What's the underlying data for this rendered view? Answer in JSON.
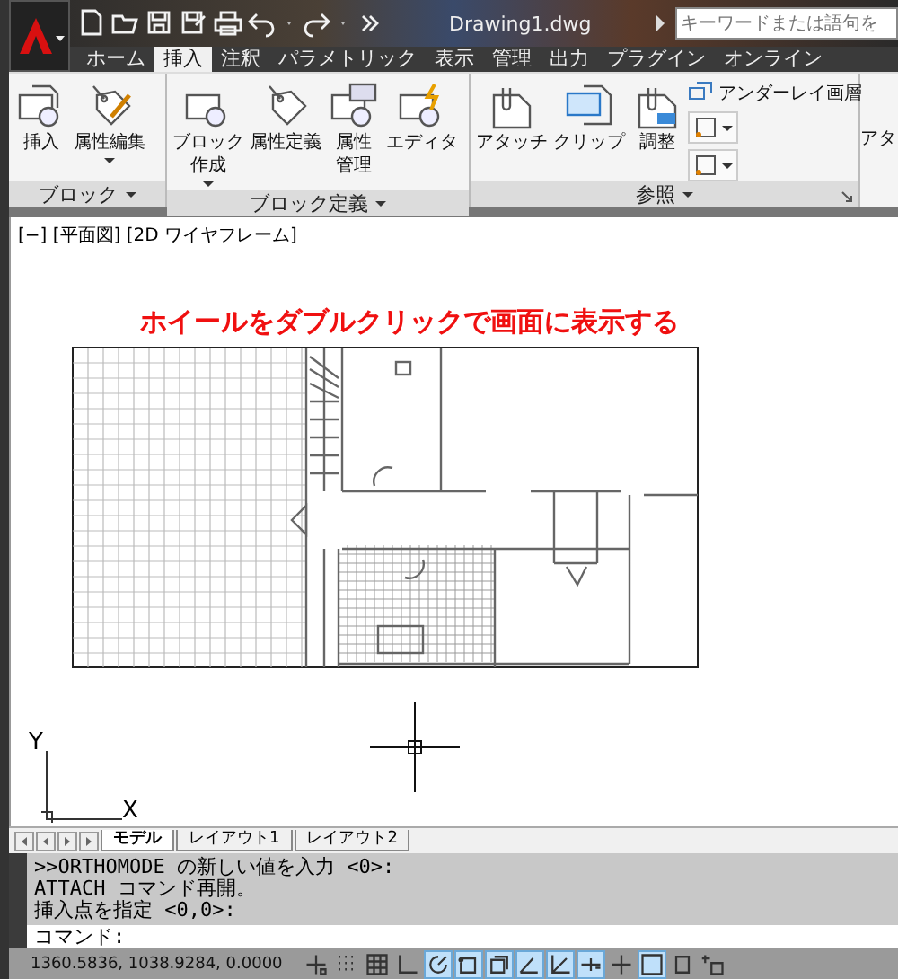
{
  "title_bar": {
    "file_title": "Drawing1.dwg",
    "search": {
      "placeholder": "キーワードまたは語句を"
    }
  },
  "quick_access": [
    {
      "kind": "new"
    },
    {
      "kind": "open"
    },
    {
      "kind": "save"
    },
    {
      "kind": "saveas"
    },
    {
      "kind": "print"
    },
    {
      "kind": "undo"
    },
    {
      "kind": "caret"
    },
    {
      "kind": "redo"
    },
    {
      "kind": "caret"
    },
    {
      "kind": "more"
    }
  ],
  "tabs": [
    {
      "label": "ホーム",
      "selected": false
    },
    {
      "label": "挿入",
      "selected": true
    },
    {
      "label": "注釈",
      "selected": false
    },
    {
      "label": "パラメトリック",
      "selected": false
    },
    {
      "label": "表示",
      "selected": false
    },
    {
      "label": "管理",
      "selected": false
    },
    {
      "label": "出力",
      "selected": false
    },
    {
      "label": "プラグイン",
      "selected": false
    },
    {
      "label": "オンライン",
      "selected": false
    }
  ],
  "panels": [
    {
      "title": "ブロック",
      "launcher": false,
      "buttons": [
        {
          "lines": [
            "挿入"
          ],
          "dropdown": false
        },
        {
          "lines": [
            "属性編集"
          ],
          "dropdown": true
        }
      ]
    },
    {
      "title": "ブロック定義",
      "launcher": false,
      "buttons": [
        {
          "lines": [
            "ブロック",
            "作成"
          ],
          "dropdown": true
        },
        {
          "lines": [
            "属性定義"
          ],
          "dropdown": false
        },
        {
          "lines": [
            "属性",
            "管理"
          ],
          "dropdown": false
        },
        {
          "lines": [
            "エディタ"
          ],
          "dropdown": false
        }
      ]
    },
    {
      "title": "参照",
      "launcher": true,
      "buttons": [
        {
          "lines": [
            "アタッチ"
          ],
          "dropdown": false
        },
        {
          "lines": [
            "クリップ"
          ],
          "dropdown": false
        },
        {
          "lines": [
            "調整"
          ],
          "dropdown": false
        }
      ],
      "small": {
        "label": "アンダーレイ画層"
      }
    },
    {
      "buttons": [
        {
          "lines": [
            "アタ"
          ]
        }
      ]
    }
  ],
  "viewport": {
    "label": "[−] [平面図] [2D ワイヤフレーム]",
    "annotation": "ホイールをダブルクリックで画面に表示する",
    "ucs": {
      "y_label": "Y",
      "x_label": "X"
    }
  },
  "layout_tabs": [
    {
      "label": "モデル",
      "selected": true
    },
    {
      "label": "レイアウト1",
      "selected": false
    },
    {
      "label": "レイアウト2",
      "selected": false
    }
  ],
  "command": {
    "history": [
      ">>ORTHOMODE の新しい値を入力 <0>:",
      "ATTACH コマンド再開。",
      "挿入点を指定 <0,0>:"
    ],
    "prompt": "コマンド:"
  },
  "status_bar": {
    "coordinates": "1360.5836, 1038.9284, 0.0000",
    "toggles": [
      {
        "kind": "snap",
        "on": false
      },
      {
        "kind": "griddots",
        "on": false
      },
      {
        "kind": "grid",
        "on": false
      },
      {
        "kind": "ortho",
        "on": false
      },
      {
        "kind": "polar",
        "on": true
      },
      {
        "kind": "osnap",
        "on": true
      },
      {
        "kind": "osnap3d",
        "on": true
      },
      {
        "kind": "otrack",
        "on": true
      },
      {
        "kind": "ducs",
        "on": true
      },
      {
        "kind": "dyn",
        "on": true
      },
      {
        "kind": "lineweight",
        "on": false
      },
      {
        "kind": "transparency",
        "on": true
      },
      {
        "kind": "qp",
        "on": false
      },
      {
        "kind": "sc",
        "on": false
      }
    ]
  }
}
